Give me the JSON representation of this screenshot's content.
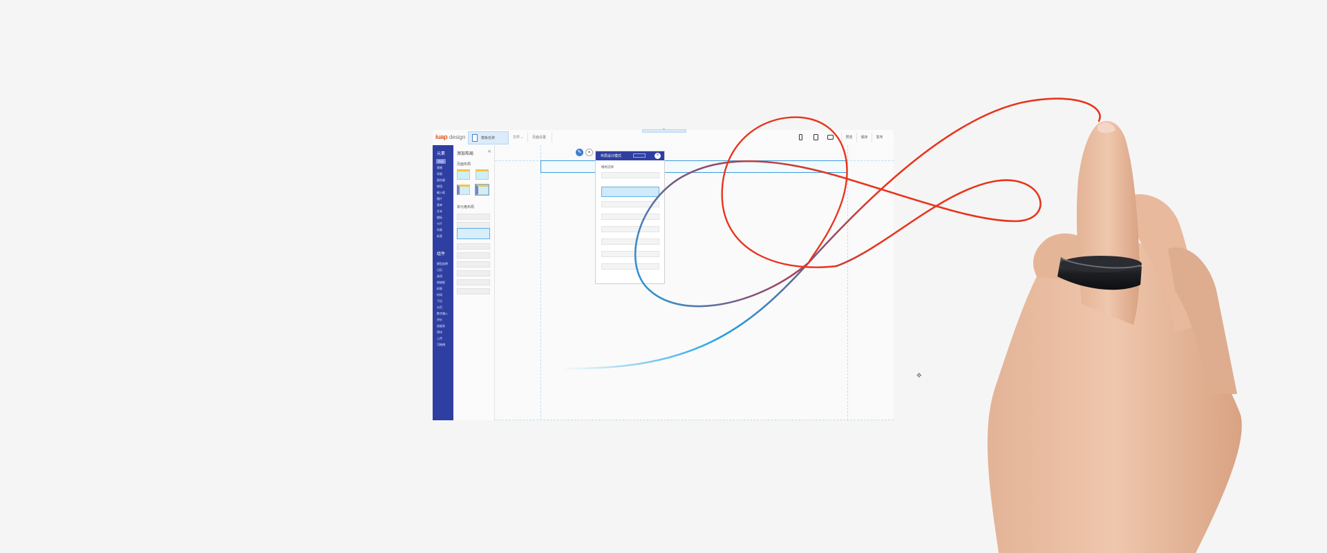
{
  "app": {
    "logo": {
      "brand": "iuap",
      "suffix": "design"
    },
    "page_tab_label": "模板名称",
    "toolbar": {
      "file_menu": "文件",
      "page_settings": "页面设置",
      "preview": "预览",
      "save": "保存",
      "publish": "发布"
    },
    "nav": {
      "section_layout": "元素",
      "layout_items": [
        "布局",
        "表格",
        "导航",
        "面包屑",
        "按钮",
        "输入框",
        "图片",
        "表单",
        "文本",
        "图标",
        "卡片",
        "列表",
        "标签"
      ],
      "section_components": "组件",
      "component_items": [
        "模型选择",
        "日历",
        "选项",
        "穿梭框",
        "树表",
        "时间",
        "下拉",
        "分页",
        "数字输入",
        "评价",
        "进度条",
        "滑块",
        "上传",
        "可拖拽"
      ]
    },
    "panel": {
      "title": "添加布局",
      "section_page_layout": "页面布局",
      "section_cell_layout": "单元格布局"
    },
    "dialog": {
      "title": "布局设计模式",
      "subtitle": "栅格选择"
    }
  },
  "colors": {
    "nav_bg": "#2f3fa1",
    "accent_blue": "#3d7ed1",
    "thread_red": "#e8341c",
    "thread_blue": "#1aa3e6",
    "ring": "#1c1e22"
  },
  "icons": [
    "document-icon",
    "chevron-down-icon",
    "phone-icon",
    "tablet-icon",
    "desktop-icon",
    "collapse-icon",
    "edit-icon",
    "delete-icon",
    "close-icon",
    "move-icon"
  ]
}
